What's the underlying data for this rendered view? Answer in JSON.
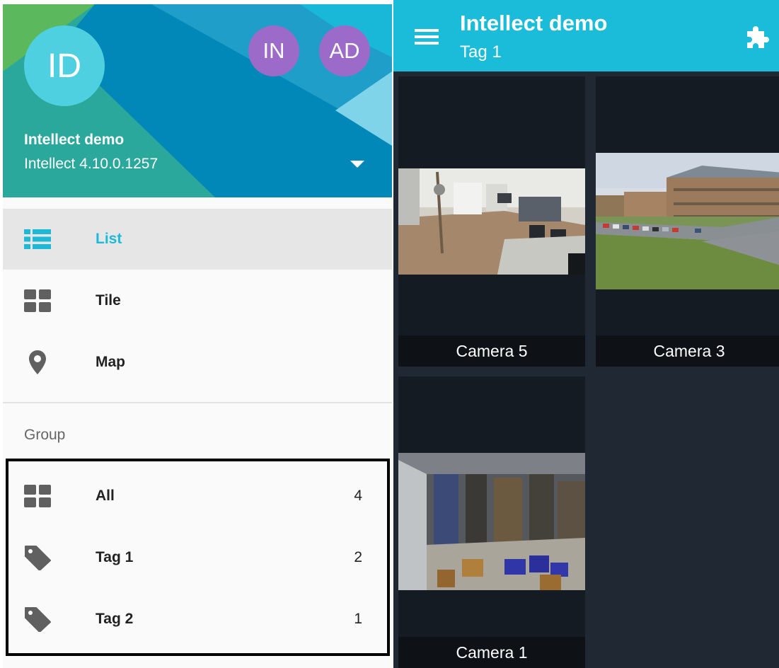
{
  "drawer": {
    "avatar_main": "ID",
    "avatar_accounts": [
      "IN",
      "AD"
    ],
    "server_name": "Intellect demo",
    "server_version": "Intellect 4.10.0.1257",
    "view_items": [
      {
        "label": "List",
        "icon": "list-icon",
        "active": true
      },
      {
        "label": "Tile",
        "icon": "grid-icon",
        "active": false
      },
      {
        "label": "Map",
        "icon": "map-marker-icon",
        "active": false
      }
    ],
    "group_header": "Group",
    "groups": [
      {
        "label": "All",
        "count": "4",
        "icon": "grid-icon"
      },
      {
        "label": "Tag 1",
        "count": "2",
        "icon": "tag-icon"
      },
      {
        "label": "Tag 2",
        "count": "1",
        "icon": "tag-icon"
      }
    ]
  },
  "toolbar": {
    "title": "Intellect demo",
    "subtitle": "Tag 1",
    "menu_icon": "menu-icon",
    "plugin_icon": "puzzle-icon"
  },
  "cameras": [
    {
      "name": "Camera 5",
      "scene": "office"
    },
    {
      "name": "Camera 3",
      "scene": "building-parking"
    },
    {
      "name": "Camera 1",
      "scene": "warehouse"
    }
  ],
  "colors": {
    "accent": "#1bbcd9",
    "avatar_main": "#4fd0e1",
    "avatar_accounts": "#9c6bc9",
    "tile_background": "#1f2833"
  }
}
